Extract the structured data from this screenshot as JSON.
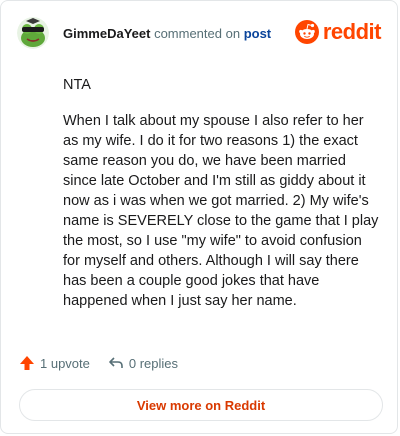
{
  "header": {
    "username": "GimmeDaYeet",
    "verb": "commented on",
    "post_link": "post",
    "brand": "reddit"
  },
  "comment": {
    "paragraphs": [
      "NTA",
      "When I talk about my spouse I also refer to her as my wife. I do it for two reasons 1) the exact same reason you do, we have been married since late October and I'm still as giddy about it now as i was when we got married. 2) My wife's name is SEVERELY close to the game that I play the most, so I use \"my wife\" to avoid confusion for myself and others. Although I will say there has been a couple good jokes that have happened when I just say her name."
    ]
  },
  "actions": {
    "upvotes": "1 upvote",
    "replies": "0 replies"
  },
  "footer": {
    "view_more": "View more on Reddit"
  },
  "colors": {
    "brand": "#ff4500",
    "link": "#0a449b",
    "upvote": "#ff4500",
    "view_more_text": "#d93900"
  },
  "icons": {
    "avatar": "frog-avatar",
    "logo": "reddit-snoo-icon",
    "upvote": "upvote-arrow-icon",
    "reply": "reply-arrow-icon"
  }
}
